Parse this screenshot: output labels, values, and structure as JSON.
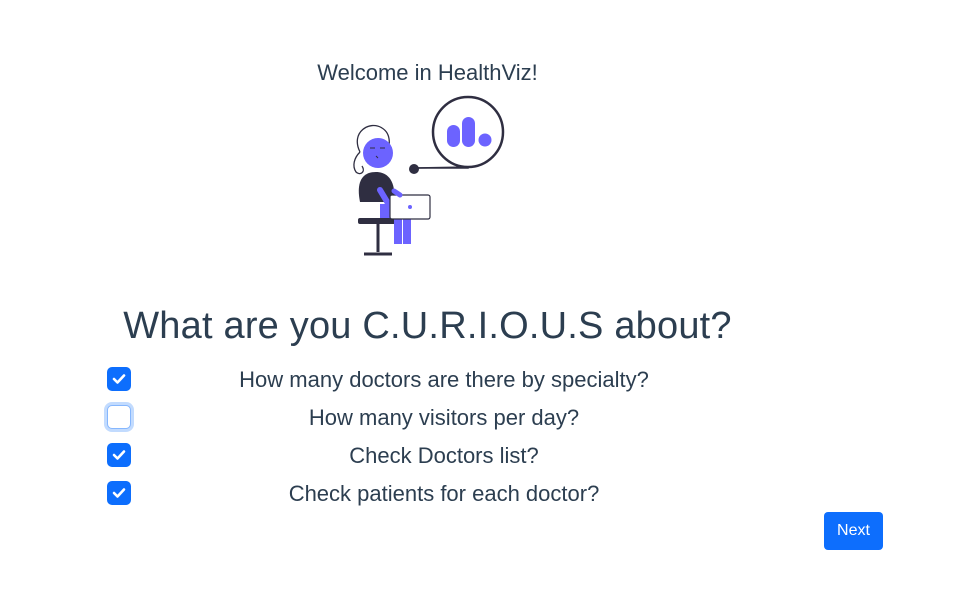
{
  "header": {
    "welcome_text": "Welcome in HealthViz!"
  },
  "illustration": {
    "icon": "person-with-laptop-chart-illustration",
    "accent_color": "#6c63ff",
    "dark_color": "#2f2e41"
  },
  "main": {
    "title": "What are you C.U.R.I.O.U.S about?",
    "options": [
      {
        "label": "How many doctors are there by specialty?",
        "checked": true
      },
      {
        "label": "How many visitors per day?",
        "checked": false
      },
      {
        "label": "Check Doctors list?",
        "checked": true
      },
      {
        "label": "Check patients for each doctor?",
        "checked": true
      }
    ]
  },
  "footer": {
    "next_label": "Next"
  },
  "colors": {
    "primary": "#0d6efd",
    "text": "#2c3e50"
  }
}
